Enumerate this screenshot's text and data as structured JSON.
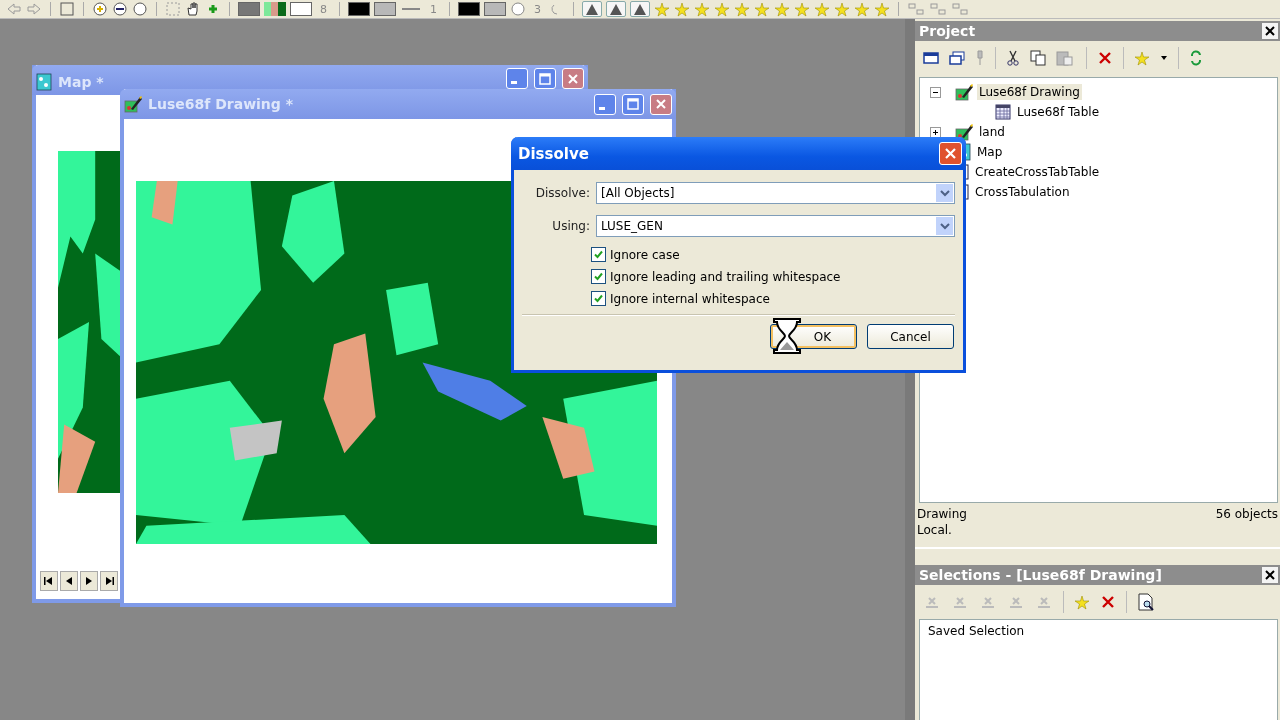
{
  "toolbar": {
    "values": [
      "8",
      "1",
      "3"
    ]
  },
  "windows": [
    {
      "title": "Map *",
      "kind": "map",
      "active": false
    },
    {
      "title": "Luse68f Drawing *",
      "kind": "drawing",
      "active": false
    }
  ],
  "dialog": {
    "title": "Dissolve",
    "fields": [
      {
        "label": "Dissolve:",
        "value": "[All Objects]"
      },
      {
        "label": "Using:",
        "value": "LUSE_GEN"
      }
    ],
    "checkboxes": [
      {
        "label": "Ignore case",
        "checked": true
      },
      {
        "label": "Ignore leading and trailing whitespace",
        "checked": true
      },
      {
        "label": "Ignore internal whitespace",
        "checked": true
      }
    ],
    "buttons": [
      {
        "label": "OK",
        "default": true
      },
      {
        "label": "Cancel",
        "default": false
      }
    ]
  },
  "project": {
    "title": "Project",
    "tree": [
      {
        "label": "Luse68f Drawing",
        "kind": "drawing",
        "selected": true,
        "expanded": true,
        "children": [
          {
            "label": "Luse68f Table",
            "kind": "table",
            "selected": false
          }
        ]
      },
      {
        "label": "land",
        "kind": "drawing",
        "selected": false,
        "expanded": false
      },
      {
        "label": "Map",
        "kind": "map",
        "selected": false
      },
      {
        "label": "CreateCrossTabTable",
        "kind": "query",
        "selected": false
      },
      {
        "label": "CrossTabulation",
        "kind": "query",
        "selected": false
      }
    ],
    "status": {
      "type": "Drawing",
      "count": "56 objects",
      "location": "Local."
    }
  },
  "selections": {
    "title": "Selections - [Luse68f Drawing]",
    "items": [
      "Saved Selection"
    ]
  }
}
